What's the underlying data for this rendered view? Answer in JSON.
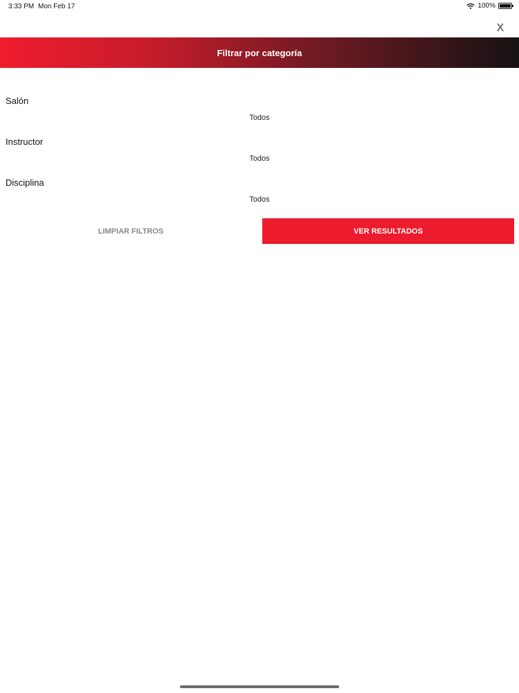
{
  "status_bar": {
    "time": "3:33 PM",
    "date": "Mon Feb 17",
    "battery_label": "100%",
    "battery_level": 1.0,
    "icons": [
      "wifi-icon",
      "battery-icon"
    ]
  },
  "close_label": "X",
  "header": {
    "title": "Filtrar por categoría"
  },
  "filters": [
    {
      "label": "Salón",
      "value": "Todos"
    },
    {
      "label": "Instructor",
      "value": "Todos"
    },
    {
      "label": "Disciplina",
      "value": "Todos"
    }
  ],
  "actions": {
    "clear_label": "LIMPIAR FILTROS",
    "results_label": "VER RESULTADOS"
  },
  "colors": {
    "accent": "#ec1c2e",
    "header_gradient_start": "#ee1c2e",
    "header_gradient_end": "#161213",
    "clear_text": "#888888"
  }
}
